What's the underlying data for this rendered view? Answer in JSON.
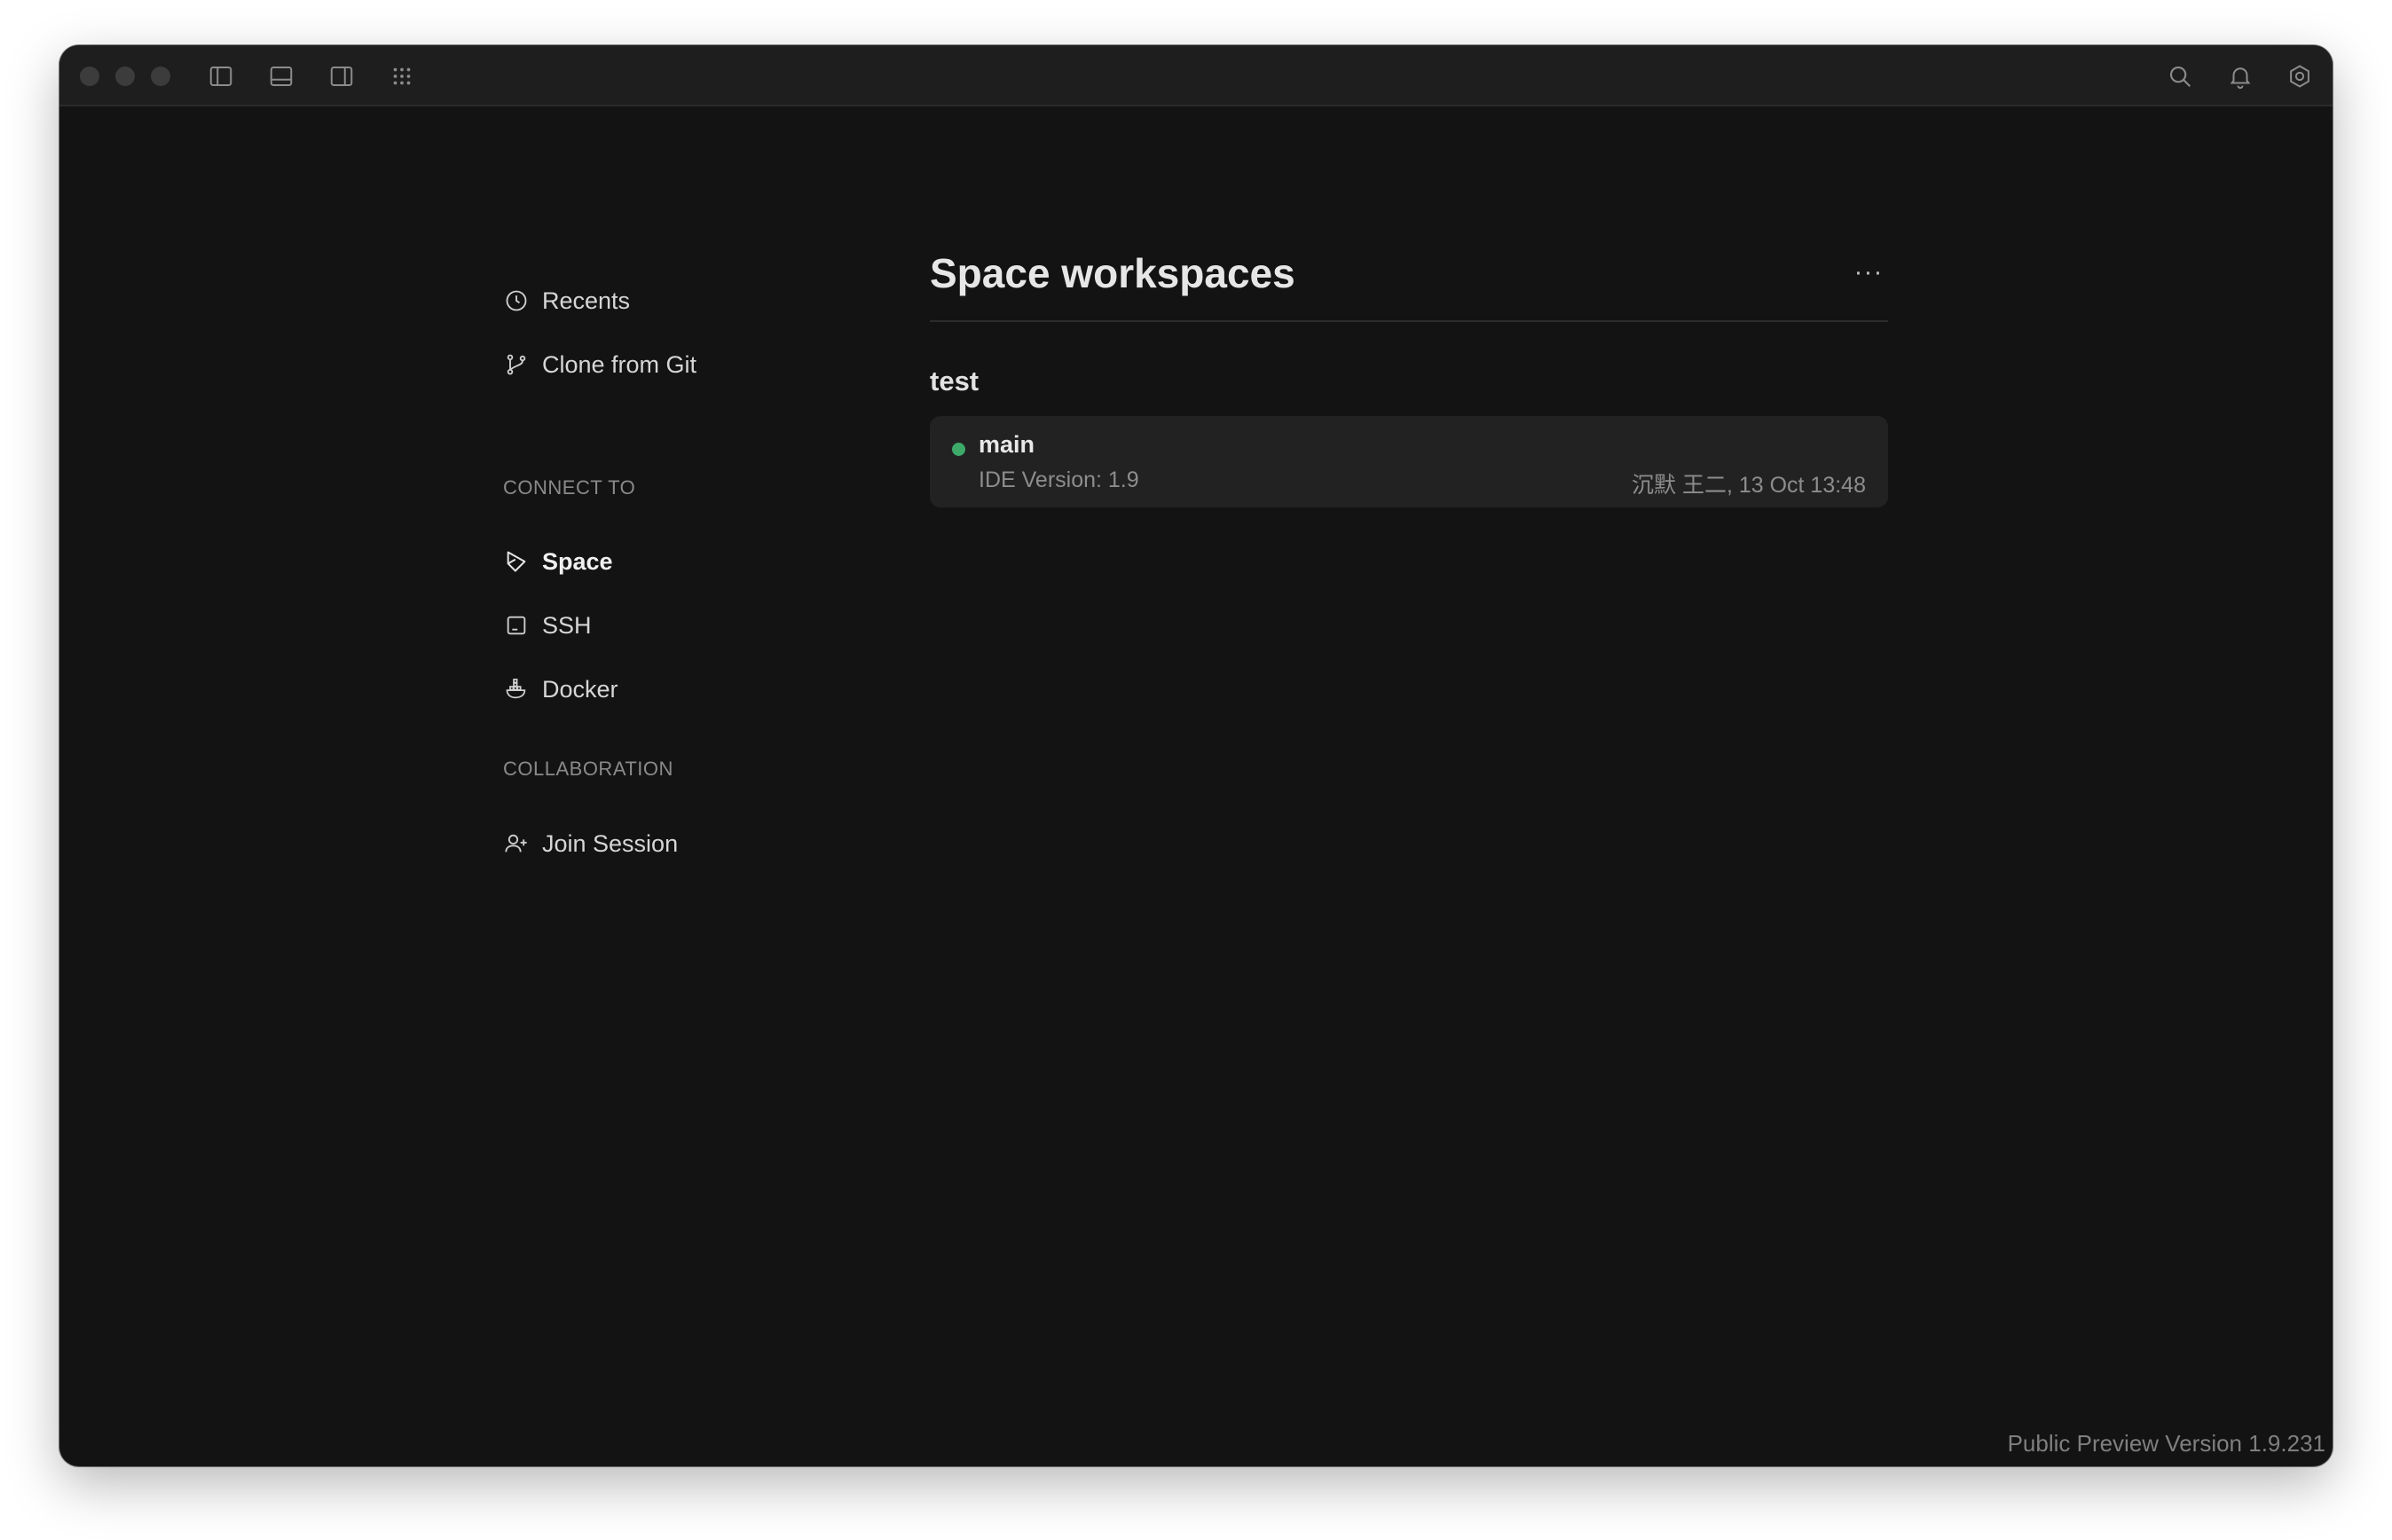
{
  "titlebar": {
    "icons": [
      "toggle-left-panel-icon",
      "toggle-bottom-panel-icon",
      "toggle-right-panel-icon",
      "apps-grid-icon",
      "search-icon",
      "bell-icon",
      "gear-icon"
    ]
  },
  "sidebar": {
    "items": [
      {
        "label": "Recents",
        "icon": "clock-icon"
      },
      {
        "label": "Clone from Git",
        "icon": "git-branch-icon"
      }
    ],
    "connect_label": "CONNECT TO",
    "connect_items": [
      {
        "label": "Space",
        "icon": "space-icon",
        "active": true
      },
      {
        "label": "SSH",
        "icon": "terminal-icon"
      },
      {
        "label": "Docker",
        "icon": "docker-icon"
      }
    ],
    "collab_label": "COLLABORATION",
    "collab_items": [
      {
        "label": "Join Session",
        "icon": "add-user-icon"
      }
    ]
  },
  "main": {
    "title": "Space workspaces",
    "more_label": "···",
    "group": {
      "name": "test",
      "workspaces": [
        {
          "name": "main",
          "status_color": "#3daa6a",
          "version": "IDE Version: 1.9",
          "meta": "沉默 王二, 13 Oct 13:48"
        }
      ]
    }
  },
  "footer": {
    "version": "Public Preview Version 1.9.231"
  },
  "colors": {
    "window_bg": "#131313",
    "titlebar_bg": "#1e1e1e",
    "card_bg": "#222222",
    "status_green": "#3daa6a"
  }
}
